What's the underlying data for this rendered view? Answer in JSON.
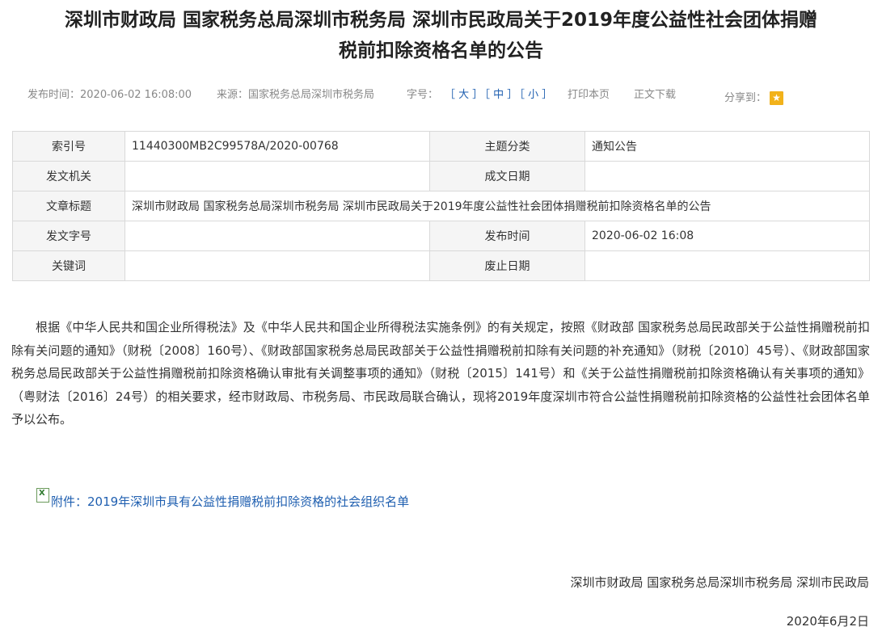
{
  "title_line1": "深圳市财政局 国家税务总局深圳市税务局 深圳市民政局关于2019年度公益性社会团体捐赠",
  "title_line2": "税前扣除资格名单的公告",
  "meta": {
    "publish_time": "发布时间：2020-06-02 16:08:00",
    "source": "来源：国家税务总局深圳市税务局",
    "font_size_label": "字号：",
    "size_large": "［ 大 ］",
    "size_medium": "［ 中 ］",
    "size_small": "［ 小 ］",
    "print": "打印本页",
    "download": "正文下载",
    "share_label": "分享到："
  },
  "share_icons": [
    "qzone-plus-icon",
    "wechat-icon",
    "weibo-icon",
    "qq-star-icon"
  ],
  "info_table": {
    "rows": [
      {
        "k1": "索引号",
        "v1": "11440300MB2C99578A/2020-00768",
        "k2": "主题分类",
        "v2": "通知公告"
      },
      {
        "k1": "发文机关",
        "v1": "",
        "k2": "成文日期",
        "v2": ""
      },
      {
        "k1": "文章标题",
        "v_full": "深圳市财政局 国家税务总局深圳市税务局 深圳市民政局关于2019年度公益性社会团体捐赠税前扣除资格名单的公告"
      },
      {
        "k1": "发文字号",
        "v1": "",
        "k2": "发布时间",
        "v2": "2020-06-02 16:08"
      },
      {
        "k1": "关键词",
        "v1": "",
        "k2": "废止日期",
        "v2": ""
      }
    ]
  },
  "body": "根据《中华人民共和国企业所得税法》及《中华人民共和国企业所得税法实施条例》的有关规定，按照《财政部 国家税务总局民政部关于公益性捐赠税前扣除有关问题的通知》（财税〔2008〕160号）、《财政部国家税务总局民政部关于公益性捐赠税前扣除有关问题的补充通知》（财税〔2010〕45号）、《财政部国家税务总局民政部关于公益性捐赠税前扣除资格确认审批有关调整事项的通知》（财税〔2015〕141号）和《关于公益性捐赠税前扣除资格确认有关事项的通知》（粤财法〔2016〕24号）的相关要求，经市财政局、市税务局、市民政局联合确认，现将2019年度深圳市符合公益性捐赠税前扣除资格的公益性社会团体名单予以公布。",
  "attachment": "附件：2019年深圳市具有公益性捐赠税前扣除资格的社会组织名单",
  "signature": "深圳市财政局  国家税务总局深圳市税务局  深圳市民政局",
  "date": "2020年6月2日"
}
